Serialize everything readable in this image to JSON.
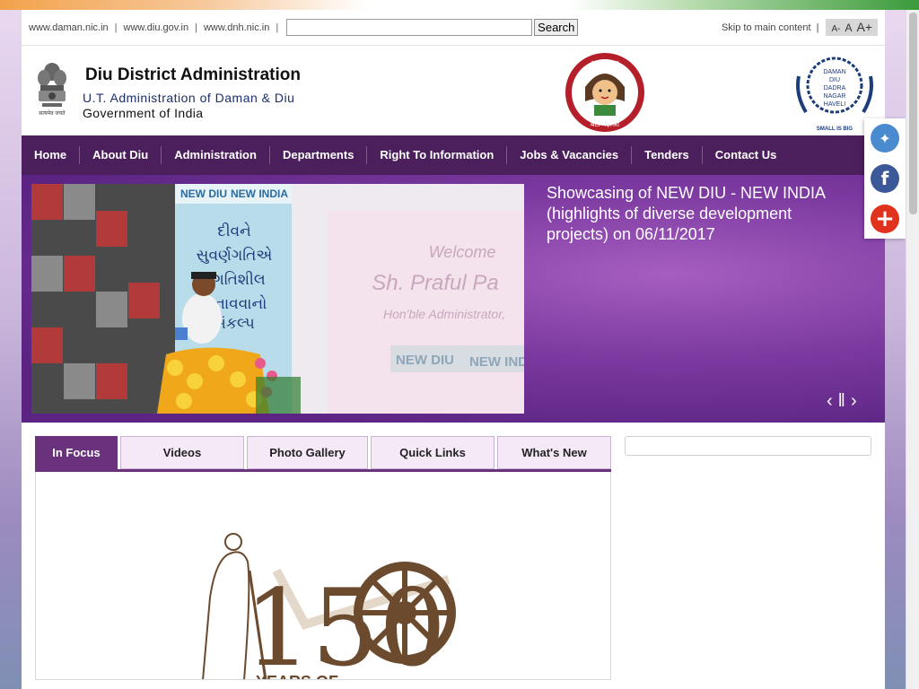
{
  "topbar": {
    "links": [
      "www.daman.nic.in",
      "www.diu.gov.in",
      "www.dnh.nic.in"
    ],
    "search_button": "Search",
    "search_placeholder": "",
    "skip_link": "Skip to main content",
    "font_small": "A-",
    "font_normal": "A",
    "font_large": "A+"
  },
  "header": {
    "title": "Diu District Administration",
    "subtitle": "U.T. Administration of Daman & Diu",
    "gov": "Government of India",
    "emblem_motto": "सत्यमेव जयते",
    "bbbp_top": "बेटी बचाओ",
    "bbbp_bottom": "बेटी पढ़ाओ",
    "tourism_lines": [
      "DAMAN",
      "DIU",
      "DADRA",
      "NAGAR",
      "HAVELI"
    ],
    "tourism_tag": "SMALL IS BIG"
  },
  "nav": {
    "items": [
      "Home",
      "About Diu",
      "Administration",
      "Departments",
      "Right To Information",
      "Jobs & Vacancies",
      "Tenders",
      "Contact Us"
    ]
  },
  "slider": {
    "caption": "Showcasing of NEW DIU - NEW INDIA (highlights of diverse development projects) on 06/11/2017",
    "banner_left": "NEW DIU",
    "banner_right": "NEW INDIA",
    "gujarati_lines": [
      "દીવને",
      "સુવર્ણગતિએ",
      "પ્રગતિશીલ",
      "બનાવવાનો",
      "સંકલ્પ"
    ],
    "welcome_lines": [
      "Welcome",
      "Sh. Praful Pa",
      "Hon'ble Administrator,"
    ],
    "footer_banner": [
      "NEW DIU",
      "NEW INDI"
    ]
  },
  "tabs": {
    "items": [
      "In Focus",
      "Videos",
      "Photo Gallery",
      "Quick Links",
      "What's New"
    ],
    "active_index": 0
  },
  "focus": {
    "graphic_number": "150",
    "graphic_text": "YEARS OF"
  },
  "social": {
    "icons": [
      "twitter-icon",
      "facebook-icon",
      "add-share-icon"
    ]
  },
  "colors": {
    "nav_bg": "#4b1f5b",
    "tab_active": "#6a327c",
    "slider_bg": "#7c3aa0"
  }
}
